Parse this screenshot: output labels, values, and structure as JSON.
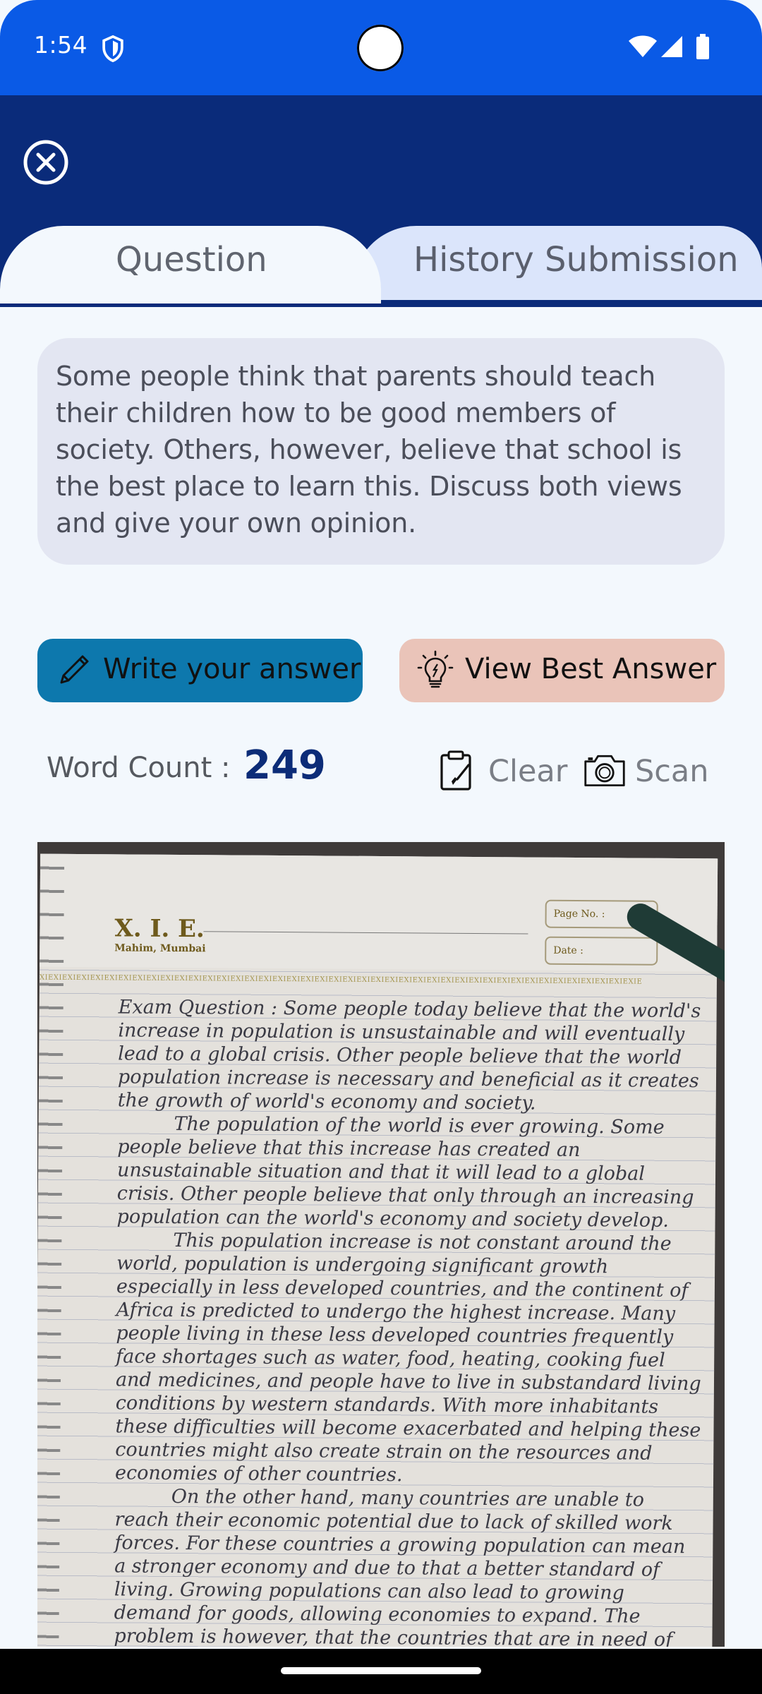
{
  "status_bar": {
    "time": "1:54"
  },
  "tabs": {
    "question": "Question",
    "history": "History Submission"
  },
  "question": {
    "text": "Some people think that parents should teach their children how to be good members of society. Others, however, believe that school is the best place to learn this. Discuss both views and give your own opinion."
  },
  "actions": {
    "write_label": "Write your answer",
    "best_label": "View Best Answer"
  },
  "word_count": {
    "label": "Word Count :",
    "value": "249"
  },
  "tools": {
    "clear_label": "Clear",
    "scan_label": "Scan"
  },
  "scan": {
    "brand": "X. I. E.",
    "brand_sub": "Mahim, Mumbai",
    "page_no_label": "Page No. :",
    "date_label": "Date :",
    "pattern": "XIEXIEXIEXIEXIEXIEXIEXIEXIEXIEXIEXIEXIEXIEXIEXIEXIEXIEXIEXIEXIEXIEXIEXIEXIEXIEXIEXIEXIEXIEXIEXIEXIEXIEXIEXIEXIEXIEXIEXIEXIEXIEXIE",
    "paragraph_1": "Exam Question : Some people today believe that the world's increase in population is unsustainable and will eventually lead to a global crisis. Other people believe that the world population increase is necessary and beneficial as it creates the growth of world's economy and society.",
    "paragraph_2": "The population of the world is ever growing. Some people believe that this increase has created an unsustainable situation and that it will lead to a global crisis. Other people believe that only through an increasing population can the world's economy and society develop.",
    "paragraph_3": "This population increase is not constant around the world, population is undergoing significant growth especially in less developed countries, and the continent of Africa is predicted to undergo the highest increase. Many people living in these less developed countries frequently face shortages such as water, food, heating, cooking fuel and medicines, and people have to live in substandard living conditions by western standards. With more inhabitants these difficulties will become exacerbated and helping these countries might also create strain on the resources and economies of other countries.",
    "paragraph_4": "On the other hand, many countries are unable to reach their economic potential due to lack of skilled work forces. For these countries a growing population can mean a stronger economy and due to that a better standard of living. Growing populations can also lead to growing demand for goods, allowing economies to expand. The problem is however, that the countries that are in need of labour forces and increasing demand are already the more"
  }
}
